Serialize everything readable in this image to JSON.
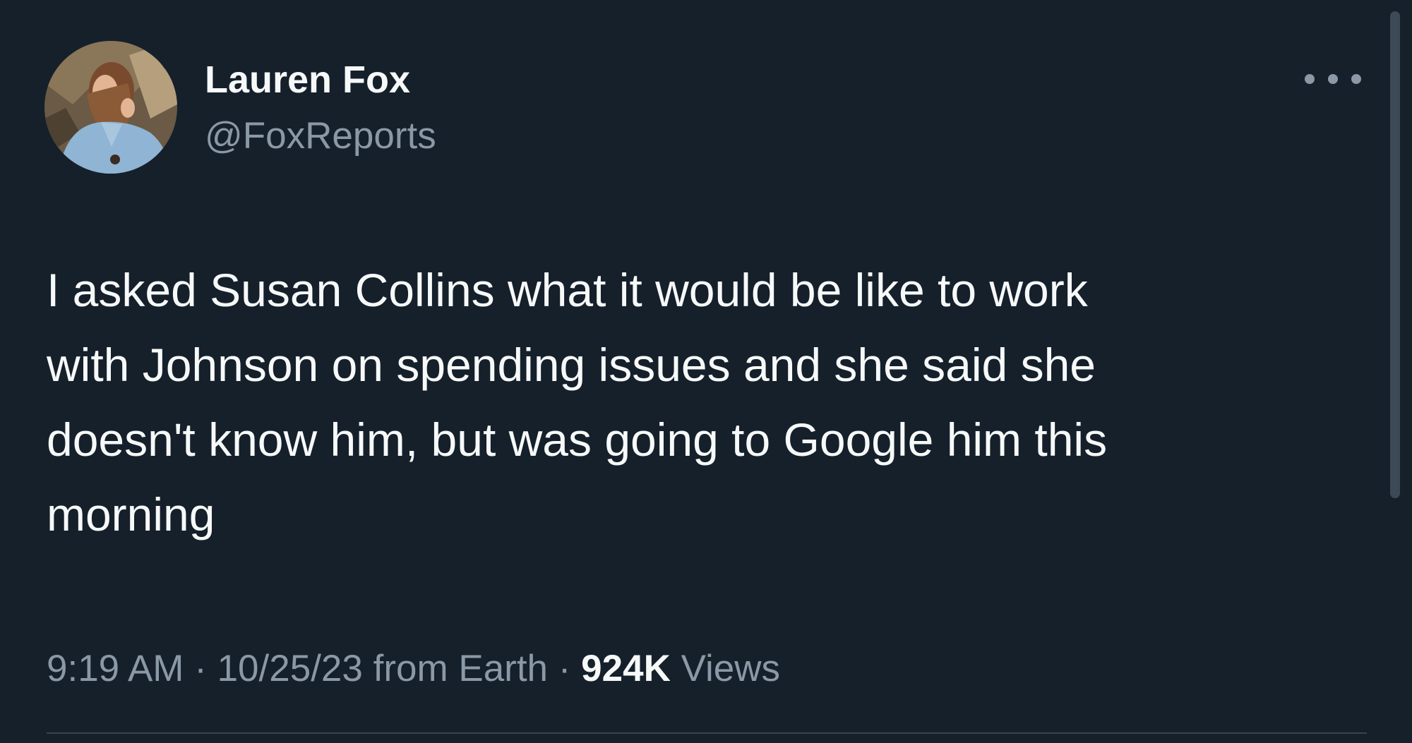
{
  "author": {
    "name": "Lauren Fox",
    "handle": "@FoxReports"
  },
  "tweet": {
    "text": "I asked Susan Collins what it would be like to work\nwith Johnson on spending issues and she said she\ndoesn't know him, but was going to Google him this\nmorning"
  },
  "meta": {
    "time": "9:19 AM",
    "separator": " · ",
    "date": "10/25/23",
    "source": " from Earth",
    "views_count": "924K",
    "views_label": " Views"
  },
  "icons": {
    "more": "more-horizontal-icon"
  },
  "colors": {
    "background": "#15202b",
    "primary_text": "#f7f9f9",
    "secondary_text": "#8b98a5",
    "divider": "#38444d"
  }
}
